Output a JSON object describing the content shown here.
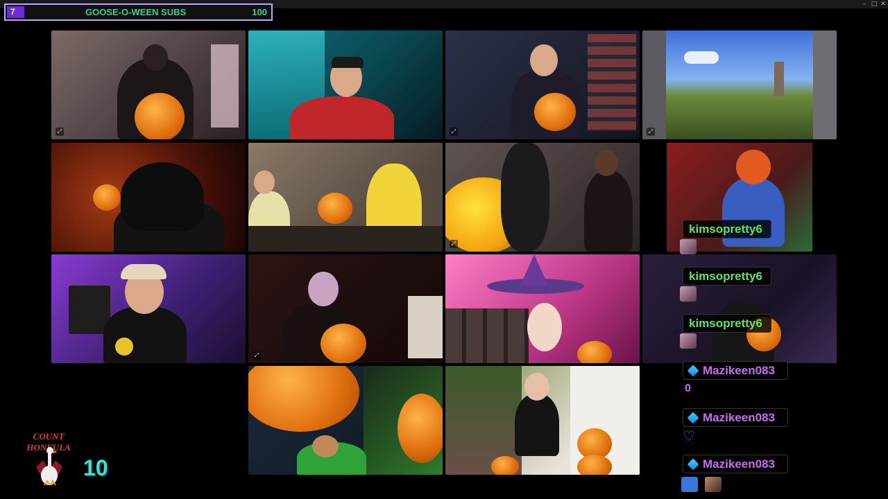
{
  "window": {
    "minimize_icon": "minimize-icon",
    "maximize_icon": "maximize-icon",
    "close_icon": "close-icon"
  },
  "subs_bar": {
    "count": "7",
    "title": "GOOSE-O-WEEN SUBS",
    "goal": "100"
  },
  "tiles": [
    {
      "id": "cam-1"
    },
    {
      "id": "cam-2"
    },
    {
      "id": "cam-3"
    },
    {
      "id": "cam-4"
    },
    {
      "id": "cam-5"
    },
    {
      "id": "cam-6"
    },
    {
      "id": "cam-7"
    },
    {
      "id": "cam-8"
    },
    {
      "id": "cam-9"
    },
    {
      "id": "cam-10"
    },
    {
      "id": "cam-11"
    },
    {
      "id": "cam-12"
    },
    {
      "id": "cam-13"
    },
    {
      "id": "cam-14"
    }
  ],
  "chat": [
    {
      "user": "kimsopretty6",
      "color": "#5ee35e"
    },
    {
      "user": "kimsopretty6",
      "color": "#5ee35e"
    },
    {
      "user": "kimsopretty6",
      "color": "#5ee35e"
    },
    {
      "user": "Mazikeen083",
      "color": "#c66cf2",
      "message": "0"
    },
    {
      "user": "Mazikeen083",
      "color": "#c66cf2"
    },
    {
      "user": "Mazikeen083",
      "color": "#c66cf2"
    }
  ],
  "logo": {
    "title": "COUNT HONKULA",
    "number": "10"
  }
}
